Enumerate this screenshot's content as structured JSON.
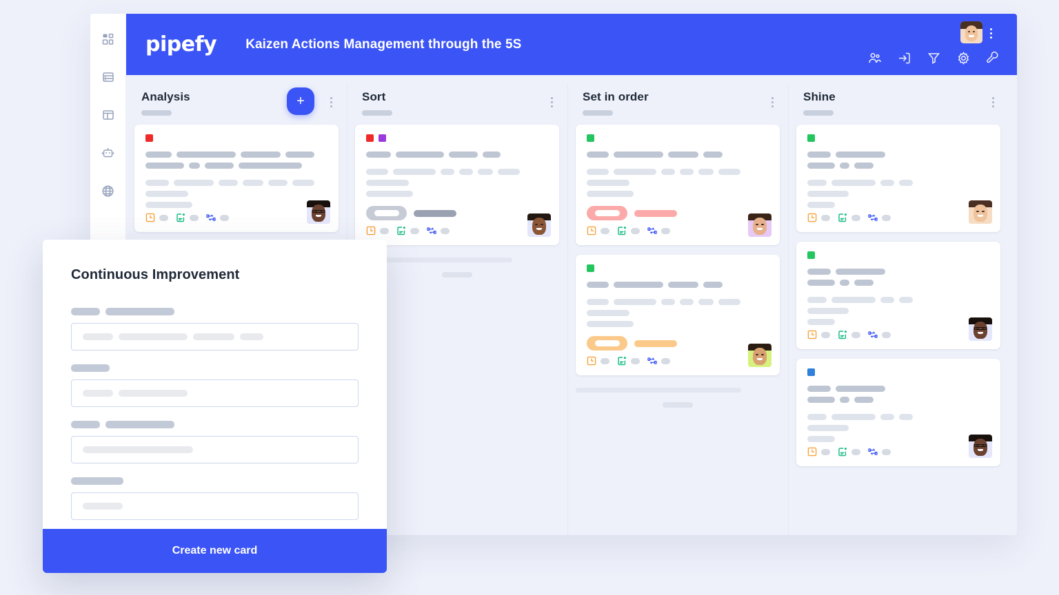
{
  "app": {
    "logo_text": "pipefy",
    "board_title": "Kaizen Actions Management through the 5S",
    "accent_color": "#3b54f6",
    "page_background": "#eef1fa"
  },
  "sidebar": {
    "items": [
      {
        "icon": "apps-grid-icon",
        "name": "sidebar-item-apps"
      },
      {
        "icon": "database-icon",
        "name": "sidebar-item-database"
      },
      {
        "icon": "layout-panel-icon",
        "name": "sidebar-item-layout"
      },
      {
        "icon": "robot-automation-icon",
        "name": "sidebar-item-automation"
      },
      {
        "icon": "globe-icon",
        "name": "sidebar-item-public"
      }
    ]
  },
  "header": {
    "tools": [
      {
        "icon": "members-icon",
        "label": "Members"
      },
      {
        "icon": "archive-inbox-icon",
        "label": "Archive"
      },
      {
        "icon": "filter-funnel-icon",
        "label": "Filter"
      },
      {
        "icon": "gear-icon",
        "label": "Settings"
      },
      {
        "icon": "wrench-icon",
        "label": "Tools"
      }
    ],
    "avatar": {
      "name": "user-avatar",
      "alt": "User profile photo"
    },
    "kebab_label": "More options"
  },
  "board": {
    "add_card_label": "+",
    "columns": [
      {
        "title": "Analysis",
        "cards": [
          {
            "chips": [
              "#ef2a2a"
            ],
            "title_bars": [
              [
                38,
                86,
                58,
                42
              ],
              [
                56,
                16,
                42,
                92
              ]
            ],
            "meta_bars": [
              [
                34,
                58,
                28,
                30,
                28,
                32
              ],
              [
                62
              ],
              [
                68
              ]
            ],
            "badge": null,
            "icons": [
              "clock-square-icon",
              "checklist-icon",
              "connector-icon"
            ],
            "avatar": "avatar-glasses-man"
          }
        ],
        "load_more_bar_width": 195
      },
      {
        "title": "Sort",
        "cards": [
          {
            "chips": [
              "#ef2a2a",
              "#9a3cdd"
            ],
            "title_bars": [
              [
                36,
                70,
                42,
                26
              ]
            ],
            "meta_bars": [
              [
                32,
                62,
                20,
                20,
                22,
                32
              ],
              [
                62
              ],
              [
                68
              ]
            ],
            "badge": {
              "pill": "#c6cbd6",
              "bar": "#9aa2b1"
            },
            "icons": [
              "clock-square-icon",
              "checklist-icon",
              "connector-icon"
            ],
            "avatar": "avatar-beard-man"
          }
        ],
        "load_more_bar_width": 228
      },
      {
        "title": "Set in order",
        "cards": [
          {
            "chips": [
              "#22c55e"
            ],
            "title_bars": [
              [
                32,
                72,
                44,
                28
              ]
            ],
            "meta_bars": [
              [
                32,
                62,
                20,
                20,
                22,
                32
              ],
              [
                62
              ],
              [
                68
              ]
            ],
            "badge": {
              "pill": "#fba9a9",
              "bar": "#fba9a9"
            },
            "icons": [
              "clock-square-icon",
              "checklist-icon",
              "connector-icon"
            ],
            "avatar": "avatar-purple-bg-man"
          },
          {
            "chips": [
              "#22c55e"
            ],
            "title_bars": [
              [
                32,
                72,
                44,
                28
              ]
            ],
            "meta_bars": [
              [
                32,
                62,
                20,
                20,
                22,
                32
              ],
              [
                62
              ],
              [
                68
              ]
            ],
            "badge": {
              "pill": "#fbc98a",
              "bar": "#fbc98a"
            },
            "icons": [
              "clock-square-icon",
              "checklist-icon",
              "connector-icon"
            ],
            "avatar": "avatar-green-bg-man"
          }
        ],
        "load_more_bar_width": 240
      },
      {
        "title": "Shine",
        "cards": [
          {
            "chips": [
              "#22c55e"
            ],
            "title_bars": [
              [
                34,
                72
              ],
              [
                40,
                14,
                28
              ]
            ],
            "meta_bars": [
              [
                28,
                64,
                20,
                20
              ],
              [
                60
              ],
              [
                40
              ]
            ],
            "badge": null,
            "icons": [
              "clock-square-icon",
              "checklist-icon",
              "connector-icon"
            ],
            "avatar": "avatar-woman"
          },
          {
            "chips": [
              "#22c55e"
            ],
            "title_bars": [
              [
                34,
                72
              ],
              [
                40,
                14,
                28
              ]
            ],
            "meta_bars": [
              [
                28,
                64,
                20,
                20
              ],
              [
                60
              ],
              [
                40
              ]
            ],
            "badge": null,
            "icons": [
              "clock-square-icon",
              "checklist-icon",
              "connector-icon"
            ],
            "avatar": "avatar-glasses-man"
          },
          {
            "chips": [
              "#2f80d8"
            ],
            "title_bars": [
              [
                34,
                72
              ],
              [
                40,
                14,
                28
              ]
            ],
            "meta_bars": [
              [
                28,
                64,
                20,
                20
              ],
              [
                60
              ],
              [
                40
              ]
            ],
            "badge": null,
            "icons": [
              "clock-square-icon",
              "checklist-icon",
              "connector-icon"
            ],
            "avatar": "avatar-glasses-man"
          }
        ],
        "load_more_bar_width": 0
      }
    ]
  },
  "modal": {
    "title": "Continuous Improvement",
    "submit_label": "Create new card",
    "fields": [
      {
        "label_bars": [
          42,
          100
        ],
        "value_bars": [
          44,
          100,
          60,
          34
        ]
      },
      {
        "label_bars": [
          56
        ],
        "value_bars": [
          44,
          100
        ]
      },
      {
        "label_bars": [
          42,
          100
        ],
        "value_bars": [
          160
        ]
      },
      {
        "label_bars": [
          76
        ],
        "value_bars": [
          58
        ]
      }
    ]
  }
}
